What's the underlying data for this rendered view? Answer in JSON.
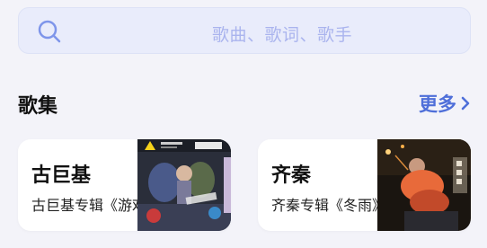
{
  "search": {
    "placeholder": "歌曲、歌词、歌手",
    "icon": "search-icon"
  },
  "section": {
    "title": "歌集",
    "more_label": "更多"
  },
  "colors": {
    "accent": "#4f6fd9",
    "placeholder": "#aab4ee",
    "background": "#f3f3f9"
  },
  "albums": [
    {
      "name": "古巨基",
      "desc": "古巨基专辑《游戏基》"
    },
    {
      "name": "齐秦",
      "desc": "齐秦专辑《冬雨》"
    }
  ]
}
